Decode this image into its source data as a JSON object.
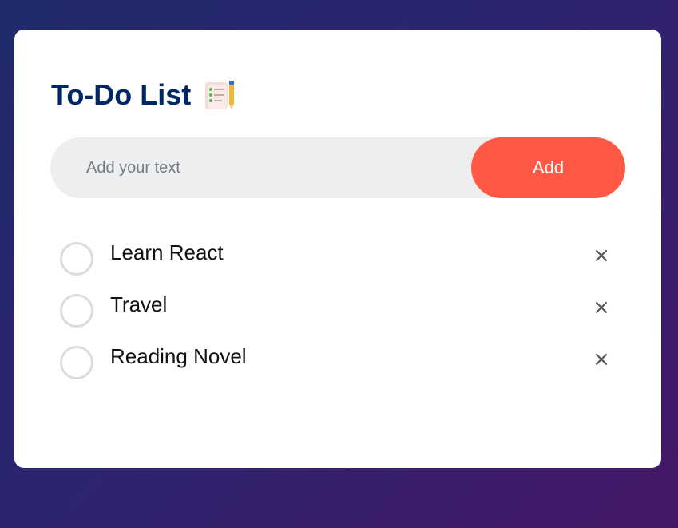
{
  "app": {
    "title": "To-Do List",
    "title_icon": "notepad-checklist-icon"
  },
  "input": {
    "value": "",
    "placeholder": "Add your text"
  },
  "add_button": {
    "label": "Add"
  },
  "tasks": [
    {
      "label": "Learn React",
      "checked": false,
      "delete_icon": "close-icon",
      "delete_glyph": "×"
    },
    {
      "label": "Travel",
      "checked": false,
      "delete_icon": "close-icon",
      "delete_glyph": "×"
    },
    {
      "label": "Reading Novel",
      "checked": false,
      "delete_icon": "close-icon",
      "delete_glyph": "×"
    }
  ],
  "colors": {
    "background_start": "#1f2a6b",
    "background_end": "#441766",
    "title": "#002765",
    "accent": "#ff5945",
    "input_bg": "#edeef0"
  }
}
